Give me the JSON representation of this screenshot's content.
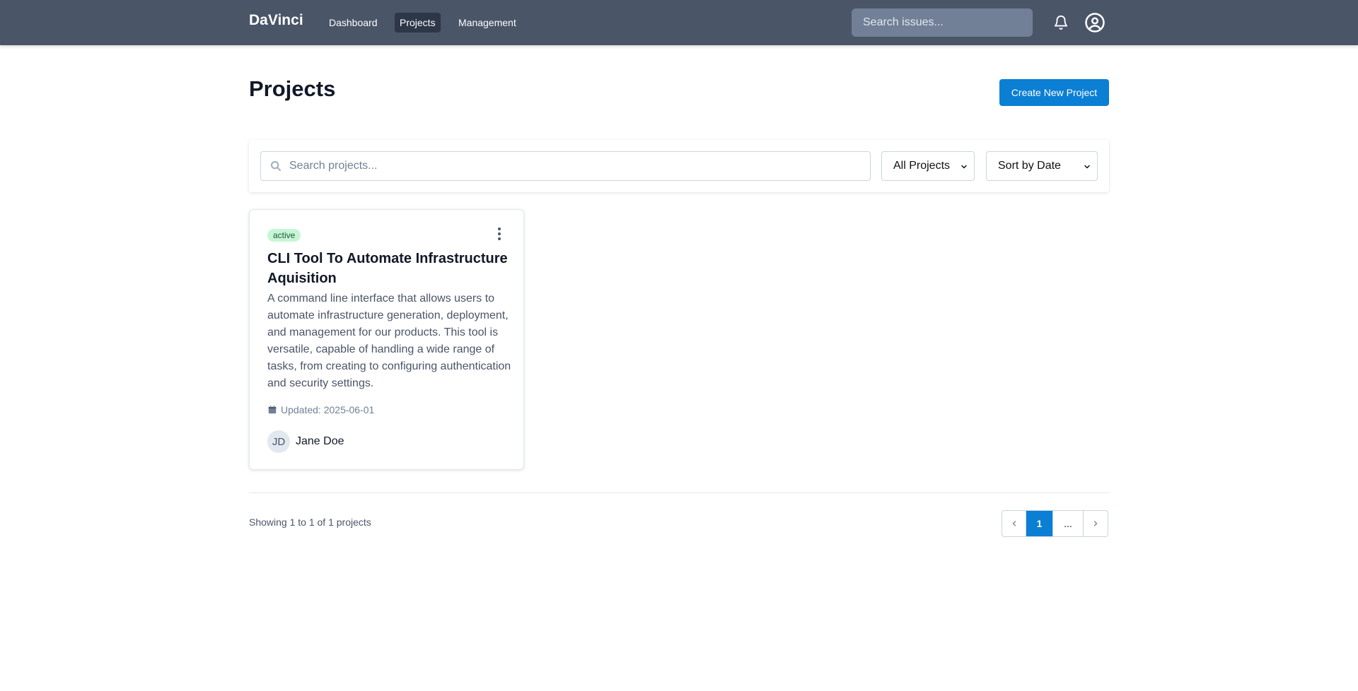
{
  "nav": {
    "brand": "DaVinci",
    "links": [
      {
        "label": "Dashboard",
        "active": false
      },
      {
        "label": "Projects",
        "active": true
      },
      {
        "label": "Management",
        "active": false
      }
    ],
    "search_placeholder": "Search issues...",
    "icons": [
      "bell-icon",
      "user-circle-icon"
    ]
  },
  "header": {
    "title": "Projects",
    "create_label": "Create New Project"
  },
  "filters": {
    "search_placeholder": "Search projects...",
    "scope_value": "All Projects",
    "sort_value": "Sort by Date"
  },
  "projects": [
    {
      "status": "active",
      "title": "CLI Tool To Automate Infrastructure Aquisition",
      "description": "A command line interface that allows users to automate infrastructure generation, deployment, and management for our products. This tool is versatile, capable of handling a wide range of tasks, from creating to configuring authentication and security settings.",
      "updated": "Updated: 2025-06-01",
      "owner_initials": "JD",
      "owner_name": "Jane Doe"
    }
  ],
  "pagination": {
    "summary": "Showing 1 to 1 of 1 projects",
    "pages": [
      "1",
      "..."
    ],
    "current_page": "1"
  },
  "colors": {
    "topbar": "#4a5568",
    "primary": "#0b7fd4",
    "badge_bg": "#c6f6d5",
    "badge_text": "#22543d"
  }
}
